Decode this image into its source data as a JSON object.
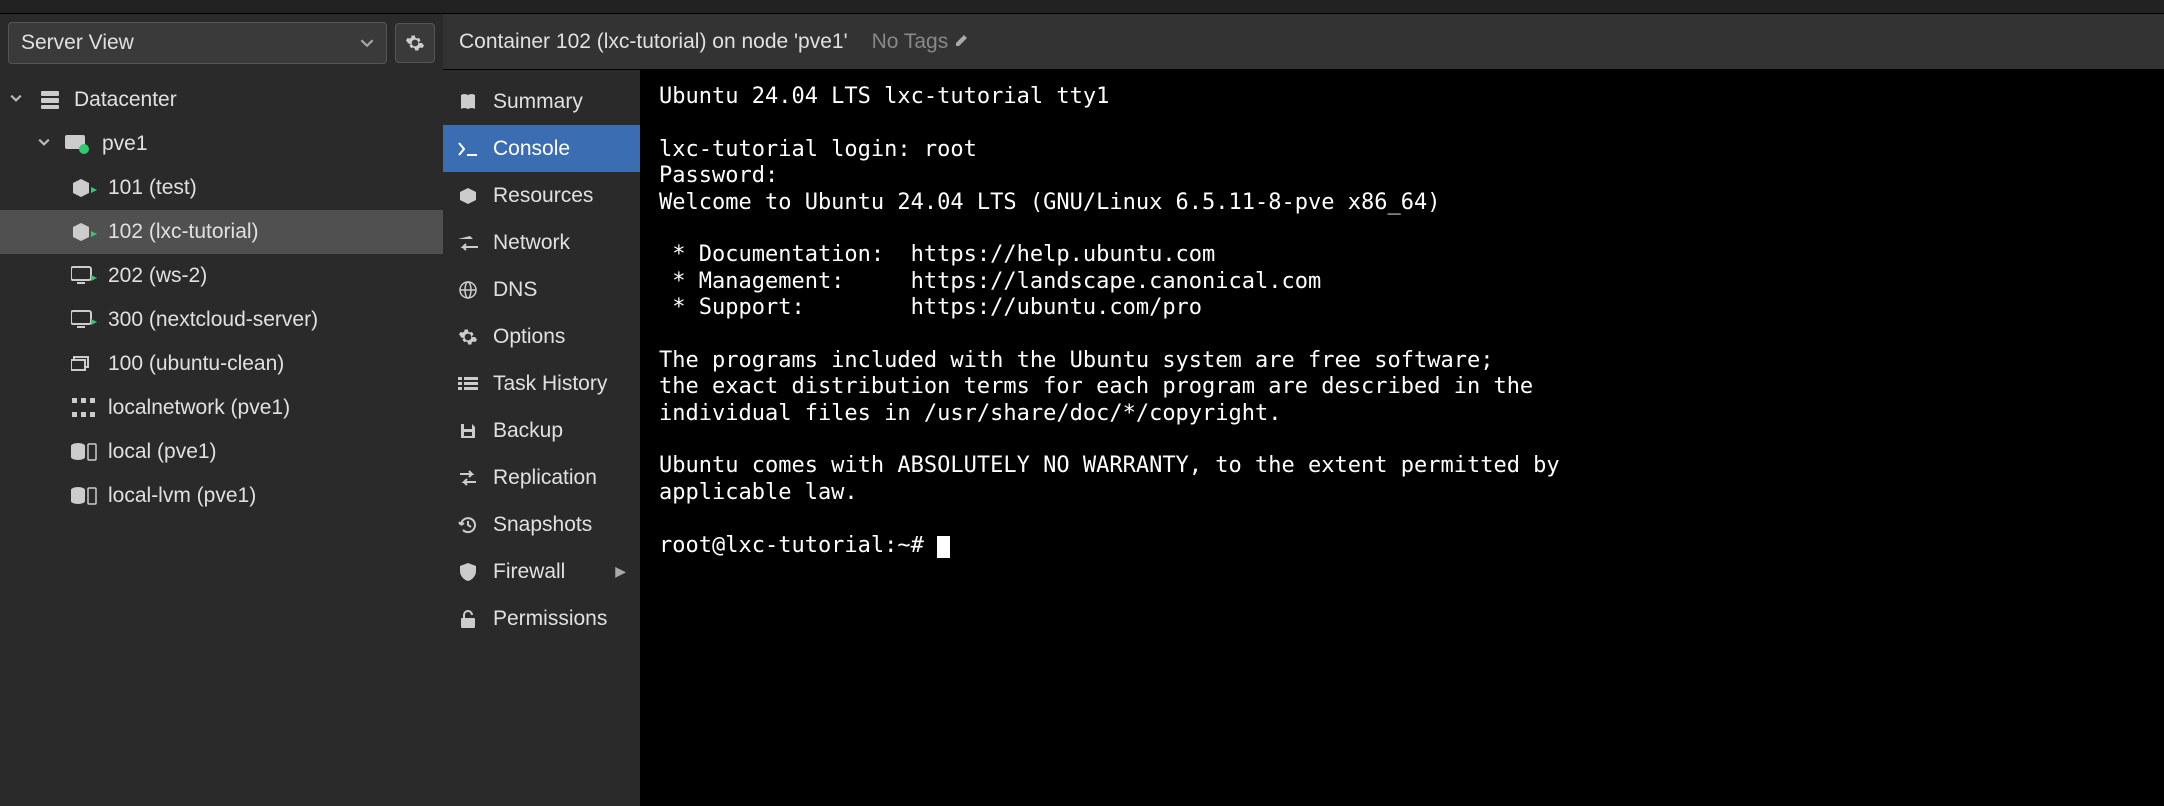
{
  "left": {
    "view_select_label": "Server View",
    "tree": {
      "datacenter": {
        "label": "Datacenter",
        "node": "pve1",
        "items": [
          {
            "label": "101 (test)",
            "type": "lxc"
          },
          {
            "label": "102 (lxc-tutorial)",
            "type": "lxc",
            "selected": true
          },
          {
            "label": "202 (ws-2)",
            "type": "vm"
          },
          {
            "label": "300 (nextcloud-server)",
            "type": "vm"
          },
          {
            "label": "100 (ubuntu-clean)",
            "type": "template"
          },
          {
            "label": "localnetwork (pve1)",
            "type": "network"
          },
          {
            "label": "local (pve1)",
            "type": "storage"
          },
          {
            "label": "local-lvm (pve1)",
            "type": "storage"
          }
        ]
      }
    }
  },
  "header": {
    "breadcrumb": "Container 102 (lxc-tutorial) on node 'pve1'",
    "tags_label": "No Tags"
  },
  "nav": {
    "items": [
      {
        "label": "Summary",
        "icon": "book"
      },
      {
        "label": "Console",
        "icon": "terminal",
        "active": true
      },
      {
        "label": "Resources",
        "icon": "cube"
      },
      {
        "label": "Network",
        "icon": "exchange"
      },
      {
        "label": "DNS",
        "icon": "globe"
      },
      {
        "label": "Options",
        "icon": "gear"
      },
      {
        "label": "Task History",
        "icon": "list"
      },
      {
        "label": "Backup",
        "icon": "save"
      },
      {
        "label": "Replication",
        "icon": "replicate"
      },
      {
        "label": "Snapshots",
        "icon": "history"
      },
      {
        "label": "Firewall",
        "icon": "shield",
        "arrow": true
      },
      {
        "label": "Permissions",
        "icon": "unlock"
      }
    ]
  },
  "console": {
    "lines": [
      "Ubuntu 24.04 LTS lxc-tutorial tty1",
      "",
      "lxc-tutorial login: root",
      "Password:",
      "Welcome to Ubuntu 24.04 LTS (GNU/Linux 6.5.11-8-pve x86_64)",
      "",
      " * Documentation:  https://help.ubuntu.com",
      " * Management:     https://landscape.canonical.com",
      " * Support:        https://ubuntu.com/pro",
      "",
      "The programs included with the Ubuntu system are free software;",
      "the exact distribution terms for each program are described in the",
      "individual files in /usr/share/doc/*/copyright.",
      "",
      "Ubuntu comes with ABSOLUTELY NO WARRANTY, to the extent permitted by",
      "applicable law.",
      "",
      "root@lxc-tutorial:~# "
    ]
  }
}
